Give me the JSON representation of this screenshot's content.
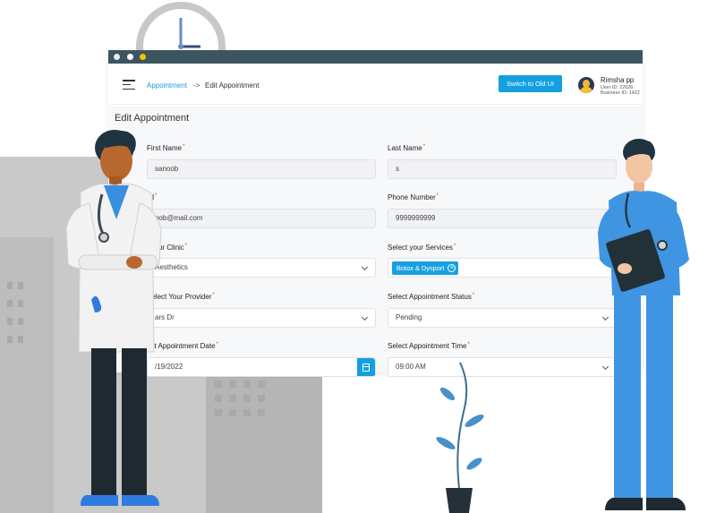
{
  "browser": {
    "dots": [
      "#e9eef0",
      "#ffffff",
      "#f5c400"
    ],
    "titlebar_color": "#3d5560"
  },
  "header": {
    "breadcrumb": {
      "link": "Appointment",
      "separator": "->",
      "current": "Edit Appointment"
    },
    "switch_button": "Switch to Old UI",
    "user": {
      "name": "Rimsha pp",
      "user_id": "User ID: 22026",
      "business_id": "Business ID: 1422"
    }
  },
  "form": {
    "title": "Edit Appointment",
    "first_name": {
      "label": "First Name",
      "value": "sanoob"
    },
    "last_name": {
      "label": "Last Name",
      "value": "s"
    },
    "email": {
      "label": "ail",
      "value": "oob@mail.com"
    },
    "phone": {
      "label": "Phone Number",
      "value": "9999999999"
    },
    "clinic": {
      "label": "t your Clinic",
      "value": "Aesthetics"
    },
    "services": {
      "label": "Select your Services",
      "tags": [
        "Botox & Dysport"
      ]
    },
    "provider": {
      "label": "Select Your Provider",
      "value": "ars Dr"
    },
    "status": {
      "label": "Select Appointment Status",
      "value": "Pending"
    },
    "date": {
      "label": "ect Appointment Date",
      "value": "/19/2022"
    },
    "time": {
      "label": "Select Appointment Time",
      "value": "09:00 AM"
    }
  },
  "colors": {
    "accent": "#14a0e0",
    "required": "#e0303a",
    "link": "#1a9bd7"
  },
  "icons": [
    "hamburger-menu-icon",
    "calendar-icon",
    "chevron-down-icon",
    "close-circle-icon",
    "clock-icon"
  ]
}
